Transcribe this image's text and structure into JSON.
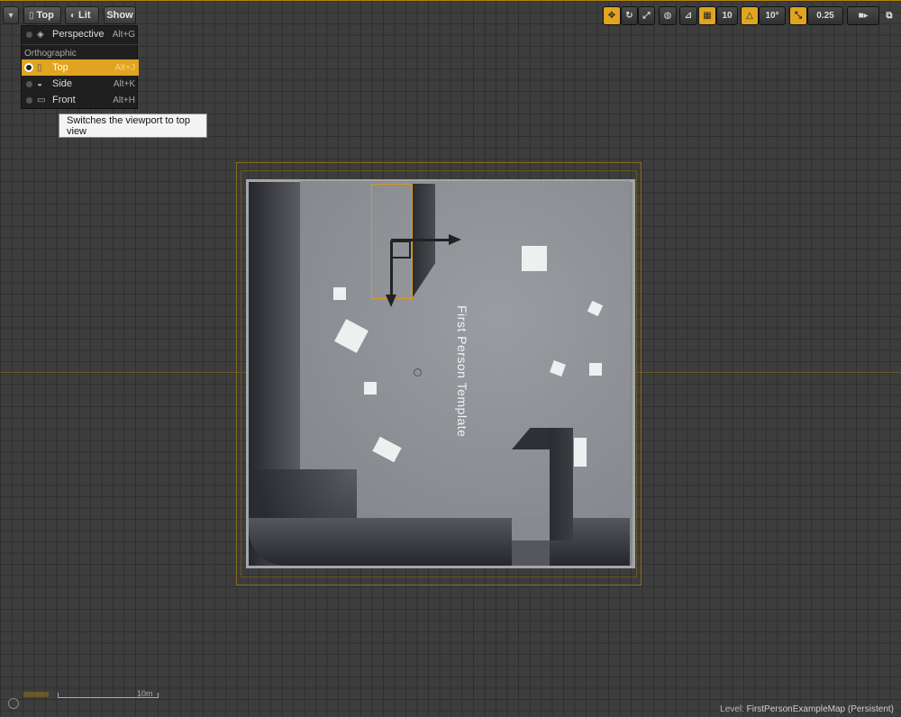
{
  "toolbar_left": {
    "view_mode": "Top",
    "lighting": "Lit",
    "show": "Show"
  },
  "view_menu": {
    "perspective": {
      "label": "Perspective",
      "shortcut": "Alt+G"
    },
    "section": "Orthographic",
    "items": [
      {
        "label": "Top",
        "shortcut": "Alt+J",
        "selected": true
      },
      {
        "label": "Side",
        "shortcut": "Alt+K",
        "selected": false
      },
      {
        "label": "Front",
        "shortcut": "Alt+H",
        "selected": false
      }
    ]
  },
  "tooltip": "Switches the viewport to top view",
  "toolbar_right": {
    "grid_snap": "10",
    "rotation_snap": "10°",
    "scale_snap": "0.25",
    "camera_speed": "",
    "accent_color": "#e0a420"
  },
  "viewport": {
    "template_label": "First Person Template",
    "scale_label": "10m"
  },
  "status": {
    "level_prefix": "Level:",
    "level_name": "FirstPersonExampleMap (Persistent)"
  }
}
